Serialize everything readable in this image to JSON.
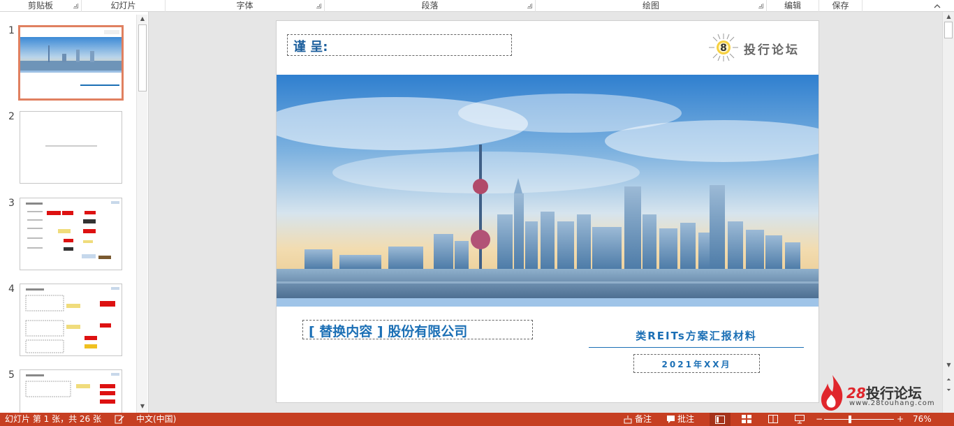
{
  "ribbon": {
    "groups": [
      {
        "label": "剪贴板"
      },
      {
        "label": "幻灯片"
      },
      {
        "label": "字体"
      },
      {
        "label": "段落"
      },
      {
        "label": "绘图"
      },
      {
        "label": "编辑"
      },
      {
        "label": "保存"
      }
    ],
    "collapse_icon": "chevron-up-icon"
  },
  "thumbnails": {
    "items": [
      {
        "number": "1",
        "selected": true
      },
      {
        "number": "2",
        "selected": false
      },
      {
        "number": "3",
        "selected": false
      },
      {
        "number": "4",
        "selected": false
      },
      {
        "number": "5",
        "selected": false
      }
    ]
  },
  "slide": {
    "addressee_label": "谨 呈:",
    "logo_text": "投行论坛",
    "logo_mark": "8",
    "company_name": "[ 替换内容 ] 股份有限公司",
    "report_title": "类REITs方案汇报材料",
    "report_date": "2021年XX月"
  },
  "watermark": {
    "number": "28",
    "name": "投行论坛",
    "url": "www.28touhang.com"
  },
  "status_bar": {
    "slide_info": "幻灯片 第 1 张，共 26 张",
    "language": "中文(中国)",
    "notes_label": "备注",
    "comments_label": "批注",
    "zoom_minus": "−",
    "zoom_plus": "+",
    "zoom_percent": "76%",
    "zoom_level": 0.76
  },
  "colors": {
    "status_bar": "#c63f22",
    "slide_blue": "#1b6fb5",
    "thumb_selected": "#e08060",
    "watermark_red": "#e0262c"
  }
}
